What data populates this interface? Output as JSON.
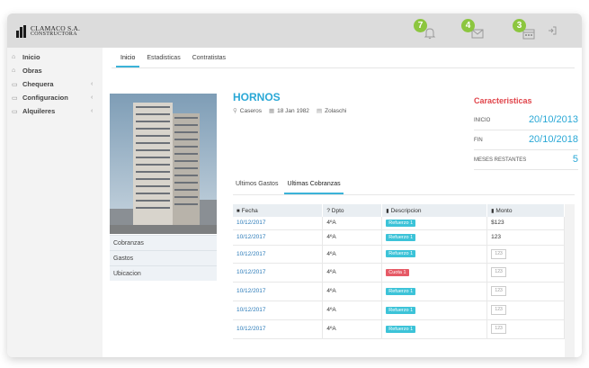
{
  "brand": {
    "line1": "CLAMACO S.A.",
    "line2": "CONSTRUCTORA"
  },
  "header": {
    "notifications": [
      {
        "count": "7",
        "icon": "bell-icon"
      },
      {
        "count": "4",
        "icon": "envelope-icon"
      },
      {
        "count": "3",
        "icon": "calendar-icon"
      }
    ],
    "logout_icon": "logout-icon"
  },
  "sidebar": {
    "items": [
      {
        "label": "Inicio",
        "icon": "home-icon",
        "glyph": "⌂",
        "has_children": false
      },
      {
        "label": "Obras",
        "icon": "building-icon",
        "glyph": "⌂",
        "has_children": false
      },
      {
        "label": "Chequera",
        "icon": "checkbook-icon",
        "glyph": "▭",
        "has_children": true
      },
      {
        "label": "Configuracion",
        "icon": "settings-icon",
        "glyph": "▭",
        "has_children": true
      },
      {
        "label": "Alquileres",
        "icon": "rent-icon",
        "glyph": "▭",
        "has_children": true
      }
    ],
    "chevron": "‹"
  },
  "main": {
    "tabs": [
      {
        "label": "Inicio",
        "active": true
      },
      {
        "label": "Estadisticas",
        "active": false
      },
      {
        "label": "Contratistas",
        "active": false
      }
    ],
    "side_links": [
      "Cobranzas",
      "Gastos",
      "Ubicacion"
    ]
  },
  "project": {
    "name": "HORNOS",
    "location": "Caseros",
    "date": "18 Jan 1982",
    "company": "Zolaschi"
  },
  "features": {
    "title": "Caracteristicas",
    "rows": [
      {
        "key": "INICIO",
        "value": "20/10/2013"
      },
      {
        "key": "FIN",
        "value": "20/10/2018"
      },
      {
        "key": "MESES RESTANTES",
        "value": "5"
      }
    ]
  },
  "subtabs": [
    {
      "label": "Ultimos Gastos",
      "active": false
    },
    {
      "label": "Ultimas Cobranzas",
      "active": true
    }
  ],
  "table": {
    "headers": [
      "Fecha",
      "? Dpto",
      "Descripcion",
      "Monto"
    ],
    "rows": [
      {
        "date": "10/12/2017",
        "dpto": "4ºA",
        "desc": "Refuerzo 1",
        "desc_type": "cyan",
        "amount": "$123",
        "amount_style": "text"
      },
      {
        "date": "10/12/2017",
        "dpto": "4ºA",
        "desc": "Refuerzo 1",
        "desc_type": "cyan",
        "amount": "123",
        "amount_style": "text"
      },
      {
        "date": "10/12/2017",
        "dpto": "4ºA",
        "desc": "Refuerzo 1",
        "desc_type": "cyan",
        "amount": "123",
        "amount_style": "box"
      },
      {
        "date": "10/12/2017",
        "dpto": "4ºA",
        "desc": "Cuota 1",
        "desc_type": "red",
        "amount": "123",
        "amount_style": "box"
      },
      {
        "date": "10/12/2017",
        "dpto": "4ºA",
        "desc": "Refuerzo 1",
        "desc_type": "cyan",
        "amount": "123",
        "amount_style": "box"
      },
      {
        "date": "10/12/2017",
        "dpto": "4ºA",
        "desc": "Refuerzo 1",
        "desc_type": "cyan",
        "amount": "123",
        "amount_style": "box"
      },
      {
        "date": "10/12/2017",
        "dpto": "4ºA",
        "desc": "Refuerzo 1",
        "desc_type": "cyan",
        "amount": "123",
        "amount_style": "box"
      }
    ]
  },
  "colors": {
    "accent": "#2aa8d6",
    "badge": "#8cc63f",
    "label_cyan": "#3cc3d8",
    "label_red": "#e65a66",
    "characteristics_title": "#e0444a"
  }
}
